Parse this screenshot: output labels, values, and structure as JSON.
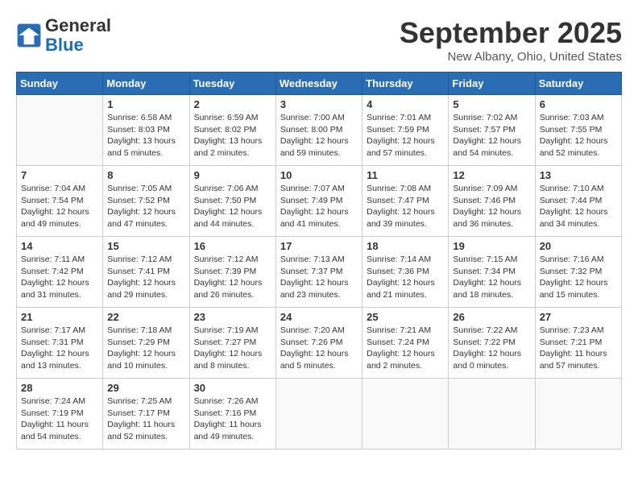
{
  "header": {
    "logo_line1": "General",
    "logo_line2": "Blue",
    "month": "September 2025",
    "location": "New Albany, Ohio, United States"
  },
  "days_of_week": [
    "Sunday",
    "Monday",
    "Tuesday",
    "Wednesday",
    "Thursday",
    "Friday",
    "Saturday"
  ],
  "weeks": [
    [
      {
        "day": null,
        "info": null
      },
      {
        "day": "1",
        "info": "Sunrise: 6:58 AM\nSunset: 8:03 PM\nDaylight: 13 hours\nand 5 minutes."
      },
      {
        "day": "2",
        "info": "Sunrise: 6:59 AM\nSunset: 8:02 PM\nDaylight: 13 hours\nand 2 minutes."
      },
      {
        "day": "3",
        "info": "Sunrise: 7:00 AM\nSunset: 8:00 PM\nDaylight: 12 hours\nand 59 minutes."
      },
      {
        "day": "4",
        "info": "Sunrise: 7:01 AM\nSunset: 7:59 PM\nDaylight: 12 hours\nand 57 minutes."
      },
      {
        "day": "5",
        "info": "Sunrise: 7:02 AM\nSunset: 7:57 PM\nDaylight: 12 hours\nand 54 minutes."
      },
      {
        "day": "6",
        "info": "Sunrise: 7:03 AM\nSunset: 7:55 PM\nDaylight: 12 hours\nand 52 minutes."
      }
    ],
    [
      {
        "day": "7",
        "info": "Sunrise: 7:04 AM\nSunset: 7:54 PM\nDaylight: 12 hours\nand 49 minutes."
      },
      {
        "day": "8",
        "info": "Sunrise: 7:05 AM\nSunset: 7:52 PM\nDaylight: 12 hours\nand 47 minutes."
      },
      {
        "day": "9",
        "info": "Sunrise: 7:06 AM\nSunset: 7:50 PM\nDaylight: 12 hours\nand 44 minutes."
      },
      {
        "day": "10",
        "info": "Sunrise: 7:07 AM\nSunset: 7:49 PM\nDaylight: 12 hours\nand 41 minutes."
      },
      {
        "day": "11",
        "info": "Sunrise: 7:08 AM\nSunset: 7:47 PM\nDaylight: 12 hours\nand 39 minutes."
      },
      {
        "day": "12",
        "info": "Sunrise: 7:09 AM\nSunset: 7:46 PM\nDaylight: 12 hours\nand 36 minutes."
      },
      {
        "day": "13",
        "info": "Sunrise: 7:10 AM\nSunset: 7:44 PM\nDaylight: 12 hours\nand 34 minutes."
      }
    ],
    [
      {
        "day": "14",
        "info": "Sunrise: 7:11 AM\nSunset: 7:42 PM\nDaylight: 12 hours\nand 31 minutes."
      },
      {
        "day": "15",
        "info": "Sunrise: 7:12 AM\nSunset: 7:41 PM\nDaylight: 12 hours\nand 29 minutes."
      },
      {
        "day": "16",
        "info": "Sunrise: 7:12 AM\nSunset: 7:39 PM\nDaylight: 12 hours\nand 26 minutes."
      },
      {
        "day": "17",
        "info": "Sunrise: 7:13 AM\nSunset: 7:37 PM\nDaylight: 12 hours\nand 23 minutes."
      },
      {
        "day": "18",
        "info": "Sunrise: 7:14 AM\nSunset: 7:36 PM\nDaylight: 12 hours\nand 21 minutes."
      },
      {
        "day": "19",
        "info": "Sunrise: 7:15 AM\nSunset: 7:34 PM\nDaylight: 12 hours\nand 18 minutes."
      },
      {
        "day": "20",
        "info": "Sunrise: 7:16 AM\nSunset: 7:32 PM\nDaylight: 12 hours\nand 15 minutes."
      }
    ],
    [
      {
        "day": "21",
        "info": "Sunrise: 7:17 AM\nSunset: 7:31 PM\nDaylight: 12 hours\nand 13 minutes."
      },
      {
        "day": "22",
        "info": "Sunrise: 7:18 AM\nSunset: 7:29 PM\nDaylight: 12 hours\nand 10 minutes."
      },
      {
        "day": "23",
        "info": "Sunrise: 7:19 AM\nSunset: 7:27 PM\nDaylight: 12 hours\nand 8 minutes."
      },
      {
        "day": "24",
        "info": "Sunrise: 7:20 AM\nSunset: 7:26 PM\nDaylight: 12 hours\nand 5 minutes."
      },
      {
        "day": "25",
        "info": "Sunrise: 7:21 AM\nSunset: 7:24 PM\nDaylight: 12 hours\nand 2 minutes."
      },
      {
        "day": "26",
        "info": "Sunrise: 7:22 AM\nSunset: 7:22 PM\nDaylight: 12 hours\nand 0 minutes."
      },
      {
        "day": "27",
        "info": "Sunrise: 7:23 AM\nSunset: 7:21 PM\nDaylight: 11 hours\nand 57 minutes."
      }
    ],
    [
      {
        "day": "28",
        "info": "Sunrise: 7:24 AM\nSunset: 7:19 PM\nDaylight: 11 hours\nand 54 minutes."
      },
      {
        "day": "29",
        "info": "Sunrise: 7:25 AM\nSunset: 7:17 PM\nDaylight: 11 hours\nand 52 minutes."
      },
      {
        "day": "30",
        "info": "Sunrise: 7:26 AM\nSunset: 7:16 PM\nDaylight: 11 hours\nand 49 minutes."
      },
      {
        "day": null,
        "info": null
      },
      {
        "day": null,
        "info": null
      },
      {
        "day": null,
        "info": null
      },
      {
        "day": null,
        "info": null
      }
    ]
  ]
}
